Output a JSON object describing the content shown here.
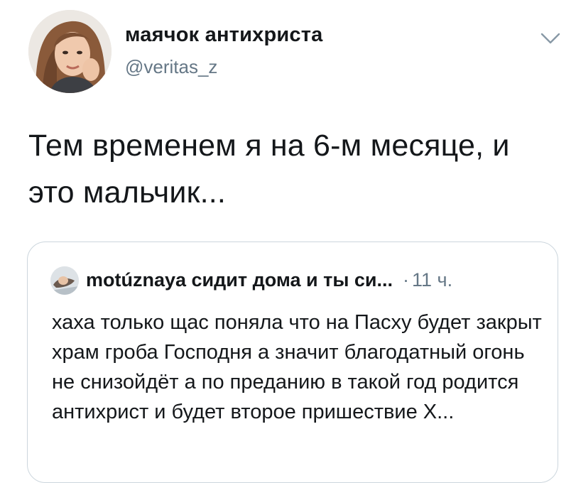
{
  "tweet": {
    "display_name": "маячок антихриста",
    "handle": "@veritas_z",
    "text": "Тем временем я на 6-м месяце, и это мальчик...",
    "avatar_icon": "user-avatar-photo",
    "menu_icon": "chevron-down-icon"
  },
  "quoted_tweet": {
    "display_name": "motúznaya сидит дома и ты си...",
    "separator": "·",
    "time": "11 ч.",
    "text": "хаха только щас поняла что на Пасху будет закрыт храм гроба Господня а значит благодатный огонь не снизойдёт а по преданию в такой год родится антихрист и будет второе пришествие Х...",
    "avatar_icon": "user-avatar-photo"
  },
  "colors": {
    "text_primary": "#14171a",
    "text_secondary": "#657786",
    "border": "#ccd6dd",
    "background": "#ffffff"
  }
}
